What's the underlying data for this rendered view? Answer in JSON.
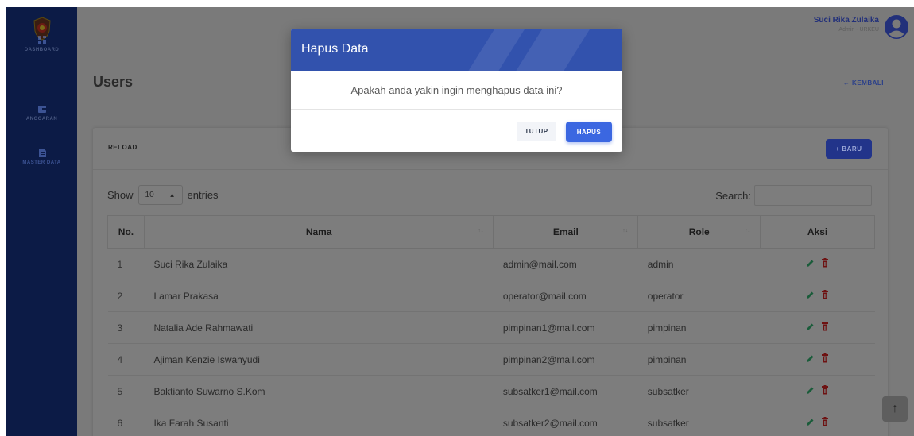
{
  "sidebar": {
    "items": [
      {
        "label": "DASHBOARD",
        "icon": "dashboard-icon"
      },
      {
        "label": "ANGGARAN",
        "icon": "wallet-icon"
      },
      {
        "label": "MASTER DATA",
        "icon": "document-icon"
      }
    ],
    "active": "MASTER DATA"
  },
  "header": {
    "user_name": "Suci Rika Zulaika",
    "user_role": "Admin - URKEU",
    "avatar_icon": "user-circle-icon"
  },
  "page": {
    "title": "Users",
    "back_label": "← KEMBALI"
  },
  "card": {
    "reload_label": "RELOAD",
    "new_label": "+ BARU",
    "show_label": "Show",
    "entries_value": "10",
    "entries_label": "entries",
    "search_label": "Search:"
  },
  "table": {
    "columns": [
      "No.",
      "Nama",
      "Email",
      "Role",
      "Aksi"
    ],
    "rows": [
      {
        "no": "1",
        "nama": "Suci Rika Zulaika",
        "email": "admin@mail.com",
        "role": "admin"
      },
      {
        "no": "2",
        "nama": "Lamar Prakasa",
        "email": "operator@mail.com",
        "role": "operator"
      },
      {
        "no": "3",
        "nama": "Natalia Ade Rahmawati",
        "email": "pimpinan1@mail.com",
        "role": "pimpinan"
      },
      {
        "no": "4",
        "nama": "Ajiman Kenzie Iswahyudi",
        "email": "pimpinan2@mail.com",
        "role": "pimpinan"
      },
      {
        "no": "5",
        "nama": "Baktianto Suwarno S.Kom",
        "email": "subsatker1@mail.com",
        "role": "subsatker"
      },
      {
        "no": "6",
        "nama": "Ika Farah Susanti",
        "email": "subsatker2@mail.com",
        "role": "subsatker"
      }
    ]
  },
  "modal": {
    "title": "Hapus Data",
    "message": "Apakah anda yakin ingin menghapus data ini?",
    "close_label": "TUTUP",
    "confirm_label": "HAPUS"
  },
  "colors": {
    "sidebar_bg": "#0c1b46",
    "modal_header": "#3252ad",
    "primary_button": "#3b67e1",
    "edit_icon": "#1a5c3a",
    "delete_icon": "#6e1212"
  }
}
